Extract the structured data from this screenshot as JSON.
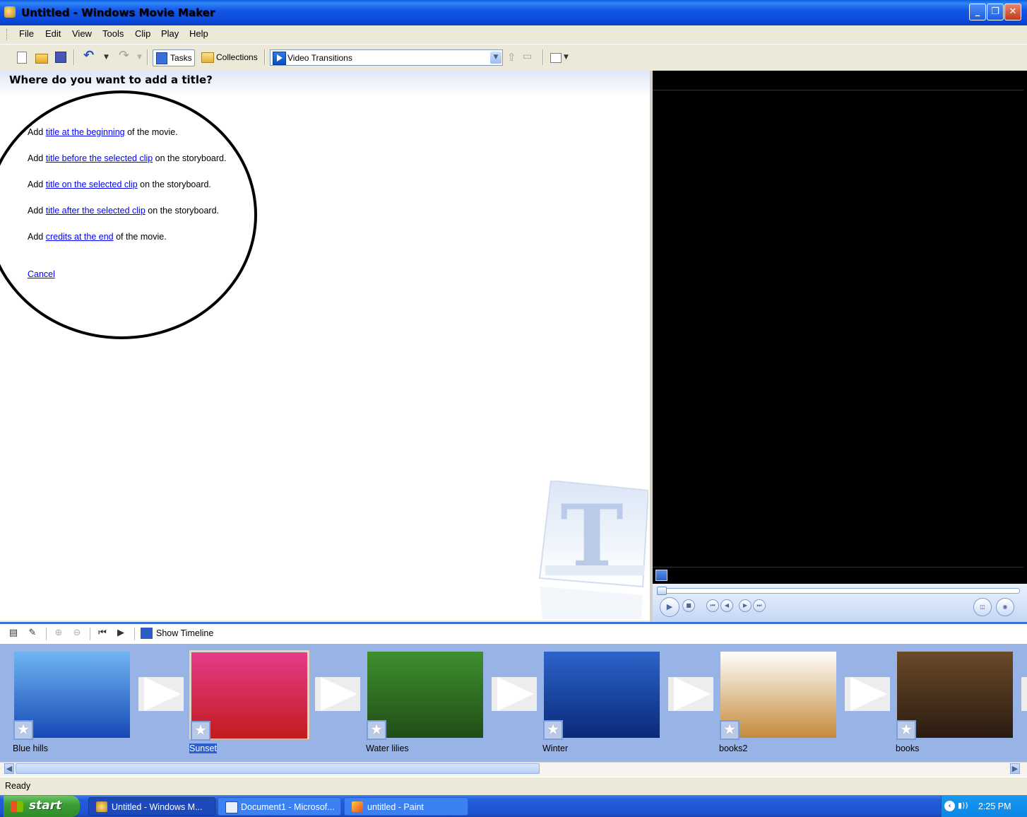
{
  "window": {
    "title": "Untitled - Windows Movie Maker",
    "controls": {
      "minimize": "_",
      "maximize": "❐",
      "close": "✕"
    }
  },
  "menu": [
    "File",
    "Edit",
    "View",
    "Tools",
    "Clip",
    "Play",
    "Help"
  ],
  "toolbar": {
    "tasks_label": "Tasks",
    "collections_label": "Collections",
    "collection_selected": "Video Transitions"
  },
  "task_pane": {
    "heading": "Where do you want to add a title?",
    "options": [
      {
        "prefix": "Add ",
        "link": "title at the beginning",
        "suffix": " of the movie."
      },
      {
        "prefix": "Add ",
        "link": "title before the selected clip",
        "suffix": " on the storyboard."
      },
      {
        "prefix": "Add ",
        "link": "title on the selected clip",
        "suffix": " on the storyboard."
      },
      {
        "prefix": "Add ",
        "link": "title after the selected clip",
        "suffix": " on the storyboard."
      },
      {
        "prefix": "Add ",
        "link": "credits at the end",
        "suffix": " of the movie."
      }
    ],
    "cancel": "Cancel"
  },
  "storyboard": {
    "show_timeline": "Show Timeline",
    "clips": [
      {
        "name": "Blue hills",
        "selected": false,
        "colors": [
          "#6fb5f2",
          "#1649b6"
        ]
      },
      {
        "name": "Sunset",
        "selected": true,
        "colors": [
          "#e53b8a",
          "#c21c1c"
        ]
      },
      {
        "name": "Water lilies",
        "selected": false,
        "colors": [
          "#3f8f2f",
          "#204d18"
        ]
      },
      {
        "name": "Winter",
        "selected": false,
        "colors": [
          "#2c63c9",
          "#0a2a78"
        ]
      },
      {
        "name": "books2",
        "selected": false,
        "colors": [
          "#ffffff",
          "#c48a3a"
        ]
      },
      {
        "name": "books",
        "selected": false,
        "colors": [
          "#6a4a2a",
          "#2a1b10"
        ]
      }
    ]
  },
  "status": "Ready",
  "taskbar": {
    "start": "start",
    "tasks": [
      {
        "label": "Untitled - Windows M...",
        "active": true
      },
      {
        "label": "Document1 - Microsof...",
        "active": false
      },
      {
        "label": "untitled - Paint",
        "active": false
      }
    ],
    "clock": "2:25 PM"
  },
  "colors": {
    "titlebar": "#0b49d8",
    "link": "#0000ff",
    "storyboard_bg": "#98b4e6",
    "monitor_bg": "#000000"
  }
}
